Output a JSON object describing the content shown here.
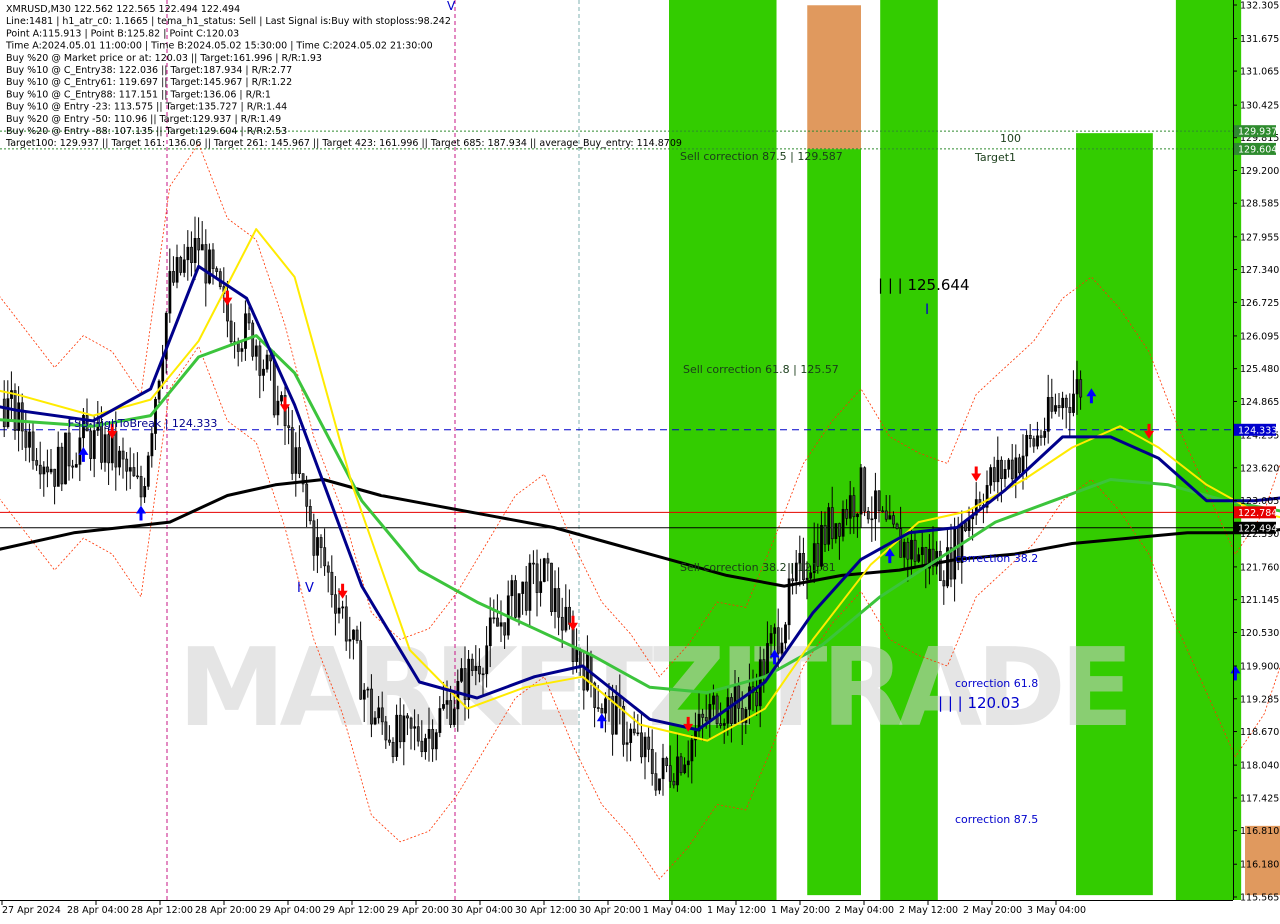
{
  "info_panel": {
    "lines": [
      "XMRUSD,M30  122.562 122.565 122.494 122.494",
      "Line:1481 | h1_atr_c0: 1.1665 | tema_h1_status: Sell | Last Signal is:Buy with stoploss:98.242",
      "Point A:115.913 | Point B:125.82 | Point C:120.03",
      "Time A:2024.05.01 11:00:00 | Time B:2024.05.02 15:30:00 | Time C:2024.05.02 21:30:00",
      "Buy %20 @ Market price or at: 120.03 || Target:161.996 | R/R:1.93",
      "Buy %10 @ C_Entry38: 122.036 || Target:187.934 | R/R:2.77",
      "Buy %10 @ C_Entry61: 119.697 || Target:145.967 | R/R:1.22",
      "Buy %10 @ C_Entry88: 117.151 || Target:136.06 | R/R:1",
      "Buy %10 @ Entry -23: 113.575 || Target:135.727 | R/R:1.44",
      "Buy %20 @ Entry -50: 110.96 || Target:129.937 | R/R:1.49",
      "Buy %20 @ Entry -88: 107.135 || Target:129.604 | R/R:2.53",
      "Target100: 129.937 || Target 161: 136.06 || Target 261: 145.967 || Target 423: 161.996 || Target 685: 187.934 || average_Buy_entry: 114.8709"
    ]
  },
  "watermark": "MARKETZITRADE",
  "annotations": {
    "sell_correction_875": "Sell correction 87.5 | 129.587",
    "sell_correction_618": "Sell correction 61.8 | 125.57",
    "sell_correction_382": "Sell correction 38.2 | 121.81",
    "target1": "Target1",
    "hundred": "100",
    "point_b_label": "| | | 125.644",
    "point_c_label": "| | | 120.03",
    "correction_382": "correction 38.2",
    "correction_618": "correction 61.8",
    "correction_875": "correction 87.5",
    "fsb_label": "FSB-HighToBreak | 124.333",
    "roman_iv": "I V",
    "roman_i": "I",
    "roman_v": "V"
  },
  "colors": {
    "bar_green": "#33cc00",
    "bar_orange": "#e0995e",
    "price_line_red": "#e60000",
    "fsb_line_blue": "#0000cc",
    "target_line_green": "#2e8b2e",
    "ma_navy": "#00008b",
    "ma_yellow": "#ffeb00",
    "ma_green": "#3cc43c",
    "ma_black": "#000000",
    "envelope_red": "#ff3300",
    "signal_blue": "#0000ff",
    "signal_red": "#ff0000"
  },
  "chart_data": {
    "type": "candlestick",
    "symbol": "XMRUSD",
    "timeframe": "M30",
    "ohlc_header": {
      "open": 122.562,
      "high": 122.565,
      "low": 122.494,
      "close": 122.494
    },
    "y_axis": {
      "ylim": [
        115.565,
        132.305
      ],
      "ticks": [
        132.305,
        131.675,
        131.065,
        130.425,
        129.815,
        129.2,
        128.585,
        127.955,
        127.34,
        126.725,
        126.095,
        125.48,
        124.865,
        124.235,
        123.62,
        123.005,
        122.39,
        121.76,
        121.145,
        120.53,
        119.9,
        119.285,
        118.67,
        118.04,
        117.425,
        116.81,
        116.18,
        115.565
      ]
    },
    "x_axis": {
      "ticks": [
        "27 Apr 2024",
        "28 Apr 04:00",
        "28 Apr 12:00",
        "28 Apr 20:00",
        "29 Apr 04:00",
        "29 Apr 12:00",
        "29 Apr 20:00",
        "30 Apr 04:00",
        "30 Apr 12:00",
        "30 Apr 20:00",
        "1 May 04:00",
        "1 May 12:00",
        "1 May 20:00",
        "2 May 04:00",
        "2 May 12:00",
        "2 May 20:00",
        "3 May 04:00"
      ]
    },
    "price_levels": [
      {
        "name": "target_129937",
        "label": "129.937",
        "value": 129.937,
        "style": "dotted",
        "color": "#2e8b2e"
      },
      {
        "name": "target_129604",
        "label": "129.604",
        "value": 129.604,
        "style": "dotted",
        "color": "#2e8b2e"
      },
      {
        "name": "fsb_high",
        "label": "124.333",
        "value": 124.333,
        "style": "dashed",
        "color": "#0000cc"
      },
      {
        "name": "last_red",
        "label": "122.784",
        "value": 122.784,
        "style": "solid",
        "color": "#e60000"
      },
      {
        "name": "last_price",
        "label": "122.494",
        "value": 122.494,
        "style": "solid",
        "color": "#000000"
      }
    ],
    "zones": [
      {
        "x": [
          0.0,
          0.56
        ],
        "color": "green"
      },
      {
        "x": [
          0.72,
          1.0
        ],
        "color": "orange",
        "y": [
          129.6,
          132.3
        ]
      },
      {
        "x": [
          0.72,
          1.0
        ],
        "color": "green",
        "y": [
          115.6,
          129.6
        ]
      },
      {
        "x": [
          1.1,
          1.4
        ],
        "color": "green"
      },
      {
        "x": [
          2.12,
          2.52
        ],
        "color": "green",
        "y": [
          115.6,
          129.9
        ]
      },
      {
        "x": [
          2.64,
          2.98
        ],
        "color": "green"
      },
      {
        "x": [
          3.0,
          3.32
        ],
        "color": "orange",
        "y": [
          115.6,
          116.9
        ]
      },
      {
        "x": [
          3.22,
          3.55
        ],
        "color": "green",
        "y": [
          115.6,
          129.6
        ]
      }
    ],
    "series": [
      {
        "name": "close",
        "points": [
          [
            -6.05,
            119.5
          ],
          [
            -5.9,
            120.8
          ],
          [
            -5.75,
            122.4
          ],
          [
            -5.6,
            123.0
          ],
          [
            -5.45,
            123.6
          ],
          [
            -5.3,
            122.7
          ],
          [
            -5.15,
            123.1
          ],
          [
            -5.0,
            124.5
          ],
          [
            -4.85,
            125.6
          ],
          [
            -4.7,
            124.7
          ],
          [
            -4.55,
            124.3
          ],
          [
            -4.4,
            124.6
          ],
          [
            -4.25,
            125.3
          ],
          [
            -4.1,
            126.2
          ],
          [
            -3.95,
            125.9
          ],
          [
            -3.8,
            124.6
          ],
          [
            -3.65,
            124.6
          ],
          [
            -3.5,
            125.0
          ],
          [
            -3.35,
            124.3
          ],
          [
            -3.2,
            123.6
          ],
          [
            -3.05,
            124.2
          ],
          [
            -2.9,
            123.9
          ],
          [
            -2.75,
            123.1
          ],
          [
            -2.6,
            127.0
          ],
          [
            -2.45,
            127.8
          ],
          [
            -2.3,
            126.4
          ],
          [
            -2.15,
            126.0
          ],
          [
            -2.0,
            124.4
          ],
          [
            -1.85,
            122.3
          ],
          [
            -1.7,
            120.9
          ],
          [
            -1.55,
            119.0
          ],
          [
            -1.4,
            118.5
          ],
          [
            -1.25,
            118.7
          ],
          [
            -1.1,
            119.4
          ],
          [
            -0.95,
            120.3
          ],
          [
            -0.8,
            121.2
          ],
          [
            -0.65,
            121.6
          ],
          [
            -0.5,
            120.3
          ],
          [
            -0.35,
            119.2
          ],
          [
            -0.2,
            118.6
          ],
          [
            -0.05,
            117.8
          ],
          [
            0.1,
            118.4
          ],
          [
            0.25,
            119.2
          ],
          [
            0.4,
            119.1
          ],
          [
            0.55,
            120.4
          ],
          [
            0.7,
            121.8
          ],
          [
            0.85,
            122.6
          ],
          [
            1.0,
            123.2
          ],
          [
            1.15,
            122.3
          ],
          [
            1.3,
            122.0
          ],
          [
            1.45,
            121.8
          ],
          [
            1.6,
            123.1
          ],
          [
            1.75,
            123.6
          ],
          [
            1.9,
            124.1
          ],
          [
            2.05,
            124.9
          ],
          [
            2.2,
            125.3
          ],
          [
            2.35,
            124.7
          ],
          [
            2.5,
            123.9
          ],
          [
            2.65,
            122.5
          ],
          [
            2.8,
            121.3
          ],
          [
            2.95,
            120.1
          ],
          [
            3.1,
            120.9
          ],
          [
            3.25,
            122.5
          ],
          [
            3.4,
            123.0
          ],
          [
            3.55,
            123.4
          ],
          [
            3.7,
            122.8
          ],
          [
            3.85,
            123.1
          ],
          [
            3.9,
            122.6
          ],
          [
            3.95,
            122.494
          ]
        ]
      },
      {
        "name": "ma_navy",
        "points": [
          [
            -6.1,
            120.0
          ],
          [
            -5.7,
            121.1
          ],
          [
            -5.3,
            122.3
          ],
          [
            -4.9,
            123.5
          ],
          [
            -4.5,
            124.6
          ],
          [
            -4.1,
            125.4
          ],
          [
            -3.8,
            125.0
          ],
          [
            -3.4,
            124.7
          ],
          [
            -3.0,
            124.5
          ],
          [
            -2.7,
            125.1
          ],
          [
            -2.45,
            127.4
          ],
          [
            -2.2,
            126.8
          ],
          [
            -1.95,
            124.8
          ],
          [
            -1.6,
            121.4
          ],
          [
            -1.3,
            119.6
          ],
          [
            -1.0,
            119.3
          ],
          [
            -0.7,
            119.7
          ],
          [
            -0.45,
            119.9
          ],
          [
            -0.1,
            118.9
          ],
          [
            0.15,
            118.7
          ],
          [
            0.5,
            119.6
          ],
          [
            0.75,
            120.9
          ],
          [
            1.0,
            121.9
          ],
          [
            1.25,
            122.4
          ],
          [
            1.5,
            122.5
          ],
          [
            1.75,
            123.2
          ],
          [
            2.05,
            124.2
          ],
          [
            2.3,
            124.2
          ],
          [
            2.55,
            123.8
          ],
          [
            2.8,
            123.0
          ],
          [
            3.05,
            123.0
          ],
          [
            3.3,
            123.1
          ],
          [
            3.55,
            123.1
          ],
          [
            3.8,
            123.2
          ],
          [
            3.95,
            123.0
          ]
        ]
      },
      {
        "name": "ma_yellow",
        "points": [
          [
            -6.1,
            119.9
          ],
          [
            -5.7,
            120.6
          ],
          [
            -5.3,
            121.7
          ],
          [
            -4.9,
            123.2
          ],
          [
            -4.5,
            124.7
          ],
          [
            -4.1,
            125.0
          ],
          [
            -3.8,
            125.3
          ],
          [
            -3.4,
            125.0
          ],
          [
            -3.0,
            124.6
          ],
          [
            -2.7,
            124.9
          ],
          [
            -2.45,
            126.0
          ],
          [
            -2.15,
            128.1
          ],
          [
            -1.95,
            127.2
          ],
          [
            -1.65,
            123.3
          ],
          [
            -1.35,
            120.2
          ],
          [
            -1.05,
            119.1
          ],
          [
            -0.75,
            119.5
          ],
          [
            -0.45,
            119.7
          ],
          [
            -0.15,
            118.8
          ],
          [
            0.2,
            118.5
          ],
          [
            0.5,
            119.1
          ],
          [
            0.75,
            120.4
          ],
          [
            1.05,
            121.8
          ],
          [
            1.3,
            122.6
          ],
          [
            1.55,
            122.8
          ],
          [
            1.85,
            123.4
          ],
          [
            2.1,
            124.0
          ],
          [
            2.35,
            124.4
          ],
          [
            2.55,
            124.0
          ],
          [
            2.8,
            123.3
          ],
          [
            3.05,
            122.8
          ],
          [
            3.3,
            122.6
          ],
          [
            3.55,
            123.0
          ],
          [
            3.8,
            123.2
          ],
          [
            3.95,
            123.0
          ]
        ]
      },
      {
        "name": "ma_green",
        "points": [
          [
            -6.1,
            119.8
          ],
          [
            -5.7,
            120.3
          ],
          [
            -5.3,
            121.0
          ],
          [
            -4.9,
            122.1
          ],
          [
            -4.5,
            123.3
          ],
          [
            -4.1,
            124.0
          ],
          [
            -3.8,
            124.6
          ],
          [
            -3.4,
            124.5
          ],
          [
            -3.0,
            124.4
          ],
          [
            -2.7,
            124.6
          ],
          [
            -2.45,
            125.7
          ],
          [
            -2.15,
            126.1
          ],
          [
            -1.95,
            125.4
          ],
          [
            -1.6,
            123.0
          ],
          [
            -1.3,
            121.7
          ],
          [
            -1.0,
            121.1
          ],
          [
            -0.7,
            120.6
          ],
          [
            -0.4,
            120.1
          ],
          [
            -0.1,
            119.5
          ],
          [
            0.2,
            119.4
          ],
          [
            0.5,
            119.7
          ],
          [
            0.8,
            120.3
          ],
          [
            1.1,
            121.2
          ],
          [
            1.4,
            121.9
          ],
          [
            1.7,
            122.6
          ],
          [
            2.0,
            123.0
          ],
          [
            2.3,
            123.4
          ],
          [
            2.6,
            123.3
          ],
          [
            2.9,
            123.0
          ],
          [
            3.2,
            122.8
          ],
          [
            3.5,
            122.8
          ],
          [
            3.8,
            122.8
          ],
          [
            3.95,
            122.8
          ]
        ]
      },
      {
        "name": "ma_black",
        "points": [
          [
            -6.1,
            119.7
          ],
          [
            -5.6,
            120.1
          ],
          [
            -5.1,
            120.5
          ],
          [
            -4.6,
            121.0
          ],
          [
            -4.1,
            121.5
          ],
          [
            -3.6,
            122.0
          ],
          [
            -3.1,
            122.4
          ],
          [
            -2.6,
            122.6
          ],
          [
            -2.3,
            123.1
          ],
          [
            -2.05,
            123.3
          ],
          [
            -1.8,
            123.4
          ],
          [
            -1.5,
            123.1
          ],
          [
            -1.2,
            122.9
          ],
          [
            -0.9,
            122.7
          ],
          [
            -0.6,
            122.5
          ],
          [
            -0.3,
            122.2
          ],
          [
            0.0,
            121.9
          ],
          [
            0.3,
            121.6
          ],
          [
            0.6,
            121.4
          ],
          [
            0.9,
            121.6
          ],
          [
            1.2,
            121.7
          ],
          [
            1.5,
            121.9
          ],
          [
            1.8,
            122.0
          ],
          [
            2.1,
            122.2
          ],
          [
            2.4,
            122.3
          ],
          [
            2.7,
            122.4
          ],
          [
            3.0,
            122.4
          ],
          [
            3.3,
            122.5
          ],
          [
            3.6,
            122.5
          ],
          [
            3.95,
            122.5
          ]
        ]
      }
    ],
    "point_labels": [
      {
        "text": "A",
        "value": 115.913,
        "time": "2024.05.01 11:00:00"
      },
      {
        "text": "B",
        "value": 125.82,
        "time": "2024.05.02 15:30:00"
      },
      {
        "text": "C",
        "value": 120.03,
        "time": "2024.05.02 21:30:00"
      }
    ]
  }
}
